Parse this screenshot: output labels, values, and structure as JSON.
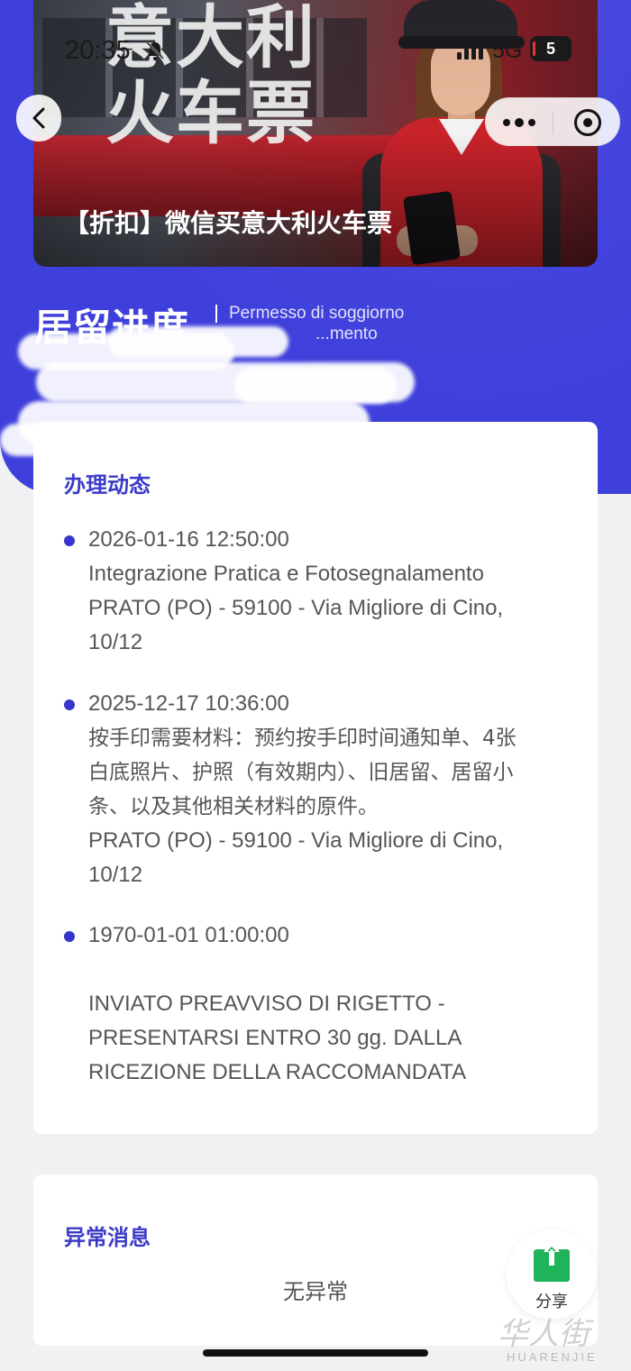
{
  "status_bar": {
    "time": "20:35",
    "network": "5G",
    "battery": "5"
  },
  "banner": {
    "headline_line1": "意大利",
    "headline_line2": "火车票",
    "caption": "【折扣】微信买意大利火车票"
  },
  "section": {
    "title": "居留进度",
    "subtitle_line1": "Permesso di soggiorno",
    "subtitle_line2": "...mento"
  },
  "progress_card": {
    "title": "办理动态",
    "items": [
      {
        "datetime": "2026-01-16 12:50:00",
        "lines": [
          "Integrazione Pratica e Fotosegnalamento",
          "PRATO (PO) - 59100 - Via Migliore di Cino,",
          "10/12"
        ]
      },
      {
        "datetime": "2025-12-17 10:36:00",
        "lines": [
          "按手印需要材料：预约按手印时间通知单、4张",
          "白底照片、护照（有效期内）、旧居留、居留小",
          "条、以及其他相关材料的原件。",
          "PRATO (PO) - 59100 - Via Migliore di Cino,",
          "10/12"
        ]
      },
      {
        "datetime": "1970-01-01 01:00:00",
        "lines": [
          "",
          "INVIATO PREAVVISO DI RIGETTO -",
          "PRESENTARSI ENTRO 30 gg. DALLA",
          "RICEZIONE DELLA RACCOMANDATA"
        ]
      }
    ]
  },
  "exception_card": {
    "title": "异常消息",
    "message": "无异常"
  },
  "share": {
    "label": "分享"
  },
  "watermark": {
    "text": "华人街",
    "subtext": "HUARENJIE"
  },
  "colors": {
    "header_blue": "#3f3fdc",
    "accent": "#3b3bc8",
    "share_green": "#1fb35a"
  },
  "icons": [
    "back-arrow-icon",
    "more-dots-icon",
    "target-icon",
    "bell-muted-icon",
    "signal-icon",
    "share-upload-icon"
  ]
}
